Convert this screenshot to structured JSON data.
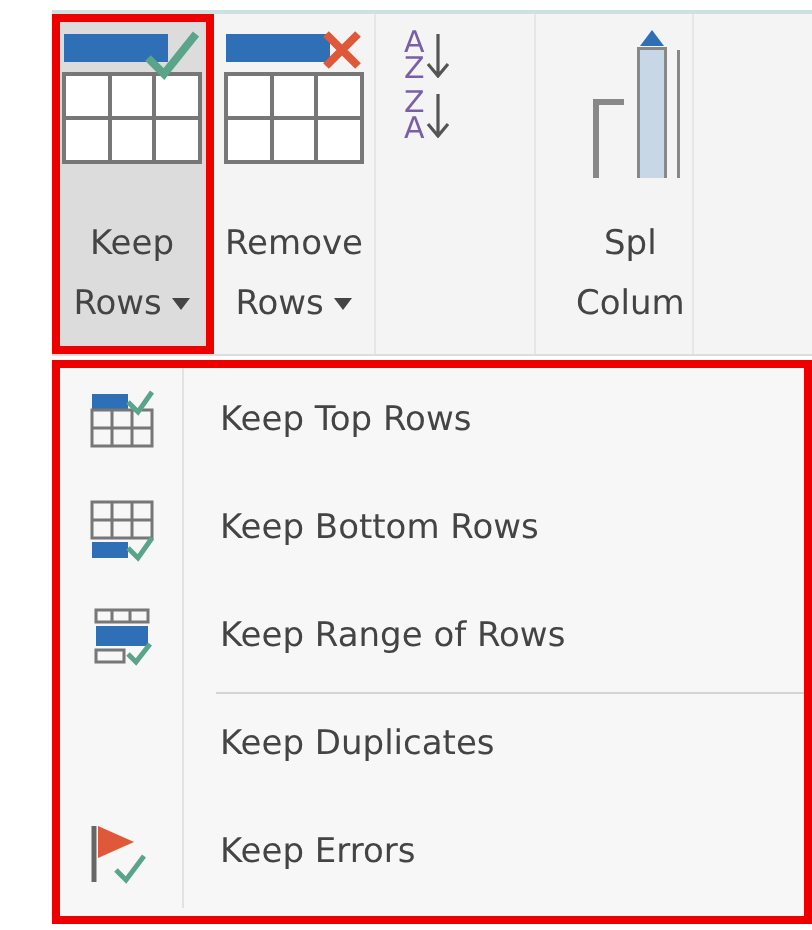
{
  "ribbon": {
    "buttons": [
      {
        "kind": "keep",
        "lines": [
          "Keep",
          "Rows"
        ],
        "dropdown": true,
        "selected": true,
        "highlighted": true
      },
      {
        "kind": "remove",
        "lines": [
          "Remove",
          "Rows"
        ],
        "dropdown": true,
        "selected": false,
        "highlighted": false
      },
      {
        "kind": "sort",
        "items": [
          {
            "top": "A",
            "bottom": "Z"
          },
          {
            "top": "Z",
            "bottom": "A"
          }
        ]
      },
      {
        "kind": "split",
        "lines": [
          "Spl",
          "Colum"
        ],
        "dropdown": false,
        "selected": false,
        "highlighted": false
      }
    ]
  },
  "menu": {
    "highlighted": true,
    "items": [
      {
        "kind": "top",
        "label": "Keep Top Rows",
        "separator_before": false
      },
      {
        "kind": "bottom",
        "label": "Keep Bottom Rows",
        "separator_before": false
      },
      {
        "kind": "range",
        "label": "Keep Range of Rows",
        "separator_before": false
      },
      {
        "kind": "plain",
        "label": "Keep Duplicates",
        "separator_before": true
      },
      {
        "kind": "errors",
        "label": "Keep Errors",
        "separator_before": false
      }
    ]
  }
}
